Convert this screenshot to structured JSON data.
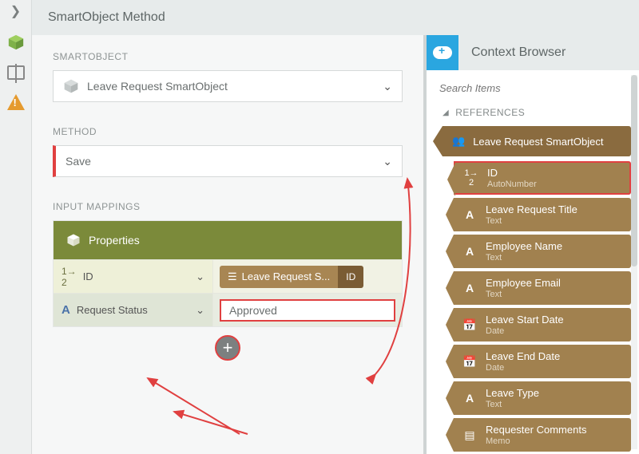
{
  "titlebar": {
    "title": "SmartObject Method"
  },
  "sections": {
    "smartobject_label": "SMARTOBJECT",
    "method_label": "METHOD",
    "mappings_label": "INPUT MAPPINGS"
  },
  "smartobject": {
    "selected": "Leave Request SmartObject"
  },
  "method": {
    "selected": "Save"
  },
  "mappings": {
    "header": "Properties",
    "rows": {
      "id": {
        "prop": "ID",
        "chip_left": "Leave Request S...",
        "chip_right": "ID"
      },
      "status": {
        "prop": "Request Status",
        "value": "Approved"
      }
    }
  },
  "context": {
    "title": "Context Browser",
    "search_placeholder": "Search Items",
    "section_label": "REFERENCES",
    "ref_header": "Leave Request SmartObject",
    "items": [
      {
        "label": "ID",
        "sub": "AutoNumber",
        "icon": "auto"
      },
      {
        "label": "Leave Request Title",
        "sub": "Text",
        "icon": "A"
      },
      {
        "label": "Employee Name",
        "sub": "Text",
        "icon": "A"
      },
      {
        "label": "Employee Email",
        "sub": "Text",
        "icon": "A"
      },
      {
        "label": "Leave Start Date",
        "sub": "Date",
        "icon": "cal"
      },
      {
        "label": "Leave End Date",
        "sub": "Date",
        "icon": "cal"
      },
      {
        "label": "Leave Type",
        "sub": "Text",
        "icon": "A"
      },
      {
        "label": "Requester Comments",
        "sub": "Memo",
        "icon": "memo"
      }
    ]
  }
}
